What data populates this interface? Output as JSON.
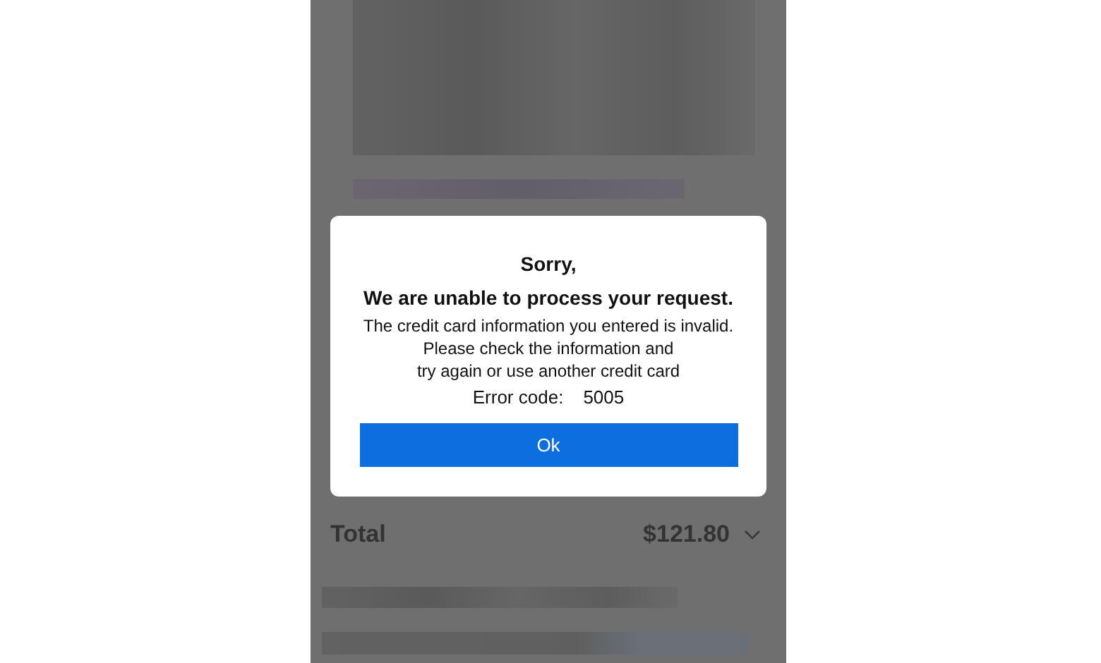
{
  "summary": {
    "label": "Total",
    "amount": "$121.80",
    "expanded": false
  },
  "dialog": {
    "title": "Sorry,",
    "heading": "We are unable to process your request.",
    "message_lines": [
      "The credit card information you entered is invalid.",
      "Please check the information and",
      "try again or use another credit card"
    ],
    "error_label": "Error code:",
    "error_code": "5005",
    "button": "Ok"
  }
}
